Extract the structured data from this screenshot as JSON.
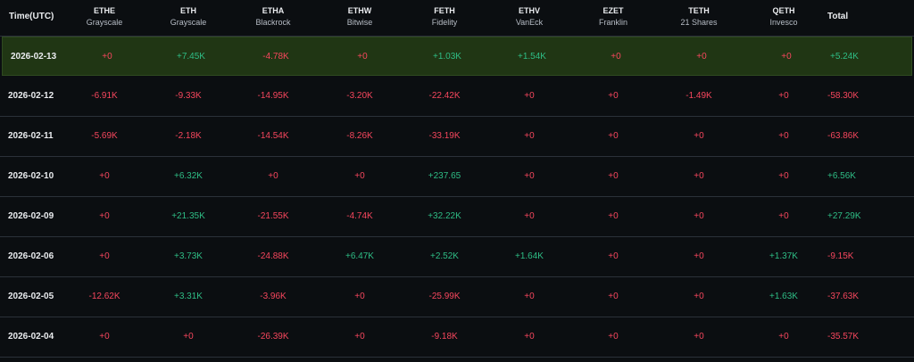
{
  "header": {
    "time_label": "Time(UTC)",
    "total_label": "Total",
    "columns": [
      {
        "ticker": "ETHE",
        "issuer": "Grayscale"
      },
      {
        "ticker": "ETH",
        "issuer": "Grayscale"
      },
      {
        "ticker": "ETHA",
        "issuer": "Blackrock"
      },
      {
        "ticker": "ETHW",
        "issuer": "Bitwise"
      },
      {
        "ticker": "FETH",
        "issuer": "Fidelity"
      },
      {
        "ticker": "ETHV",
        "issuer": "VanEck"
      },
      {
        "ticker": "EZET",
        "issuer": "Franklin"
      },
      {
        "ticker": "TETH",
        "issuer": "21 Shares"
      },
      {
        "ticker": "QETH",
        "issuer": "Invesco"
      }
    ]
  },
  "rows": [
    {
      "date": "2026-02-13",
      "values": [
        "+0",
        "+7.45K",
        "-4.78K",
        "+0",
        "+1.03K",
        "+1.54K",
        "+0",
        "+0",
        "+0"
      ],
      "total": "+5.24K"
    },
    {
      "date": "2026-02-12",
      "values": [
        "-6.91K",
        "-9.33K",
        "-14.95K",
        "-3.20K",
        "-22.42K",
        "+0",
        "+0",
        "-1.49K",
        "+0"
      ],
      "total": "-58.30K"
    },
    {
      "date": "2026-02-11",
      "values": [
        "-5.69K",
        "-2.18K",
        "-14.54K",
        "-8.26K",
        "-33.19K",
        "+0",
        "+0",
        "+0",
        "+0"
      ],
      "total": "-63.86K"
    },
    {
      "date": "2026-02-10",
      "values": [
        "+0",
        "+6.32K",
        "+0",
        "+0",
        "+237.65",
        "+0",
        "+0",
        "+0",
        "+0"
      ],
      "total": "+6.56K"
    },
    {
      "date": "2026-02-09",
      "values": [
        "+0",
        "+21.35K",
        "-21.55K",
        "-4.74K",
        "+32.22K",
        "+0",
        "+0",
        "+0",
        "+0"
      ],
      "total": "+27.29K"
    },
    {
      "date": "2026-02-06",
      "values": [
        "+0",
        "+3.73K",
        "-24.88K",
        "+6.47K",
        "+2.52K",
        "+1.64K",
        "+0",
        "+0",
        "+1.37K"
      ],
      "total": "-9.15K"
    },
    {
      "date": "2026-02-05",
      "values": [
        "-12.62K",
        "+3.31K",
        "-3.96K",
        "+0",
        "-25.99K",
        "+0",
        "+0",
        "+0",
        "+1.63K"
      ],
      "total": "-37.63K"
    },
    {
      "date": "2026-02-04",
      "values": [
        "+0",
        "+0",
        "-26.39K",
        "+0",
        "-9.18K",
        "+0",
        "+0",
        "+0",
        "+0"
      ],
      "total": "-35.57K"
    }
  ],
  "colors": {
    "positive": "#2ebd85",
    "negative": "#f6465d",
    "highlight_row": "#203614",
    "background": "#0b0e11"
  }
}
